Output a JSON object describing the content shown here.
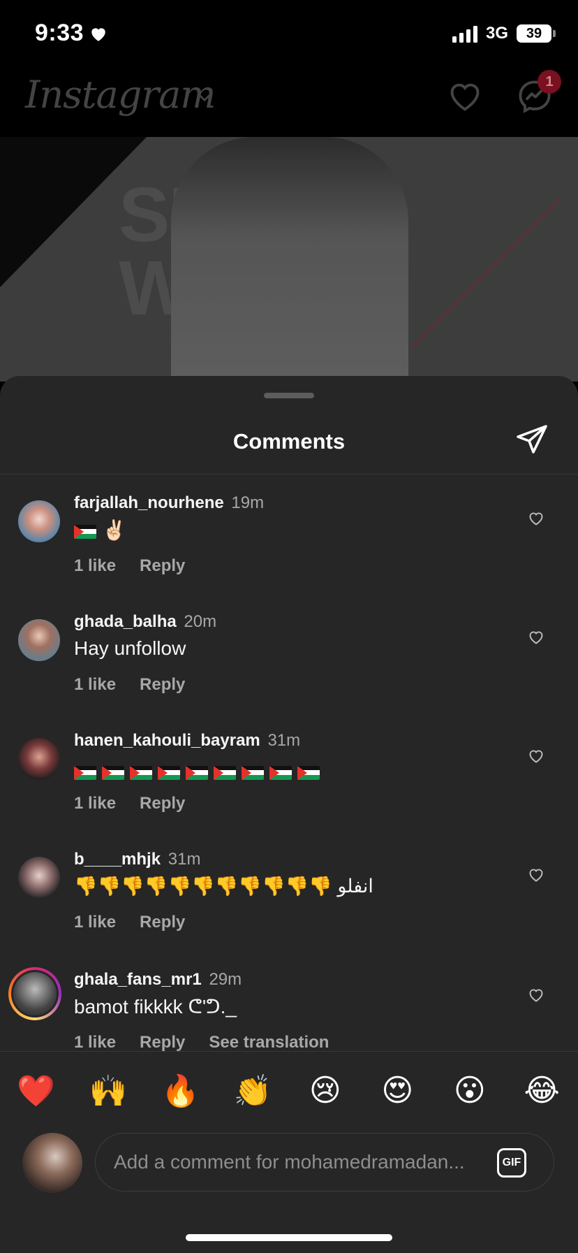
{
  "status_bar": {
    "time": "9:33",
    "network": "3G",
    "battery": "39"
  },
  "header": {
    "logo": "Instagram",
    "messages_badge": "1"
  },
  "post": {
    "bg_text_line1": "SHOW",
    "bg_text_line2": "WEEK"
  },
  "sheet": {
    "title": "Comments"
  },
  "comments": [
    {
      "user": "farjallah_nourhene",
      "time": "19m",
      "text": "✌🏻",
      "flags": 1,
      "likes": "1 like",
      "reply": "Reply"
    },
    {
      "user": "ghada_balha",
      "time": "20m",
      "text": "Hay unfollow",
      "likes": "1 like",
      "reply": "Reply"
    },
    {
      "user": "hanen_kahouli_bayram",
      "time": "31m",
      "flags": 9,
      "likes": "1 like",
      "reply": "Reply"
    },
    {
      "user": "b____mhjk",
      "time": "31m",
      "text": "👎👎👎👎👎👎👎👎👎👎👎 انفلو",
      "likes": "1 like",
      "reply": "Reply"
    },
    {
      "user": "ghala_fans_mr1",
      "time": "29m",
      "text": "bamot fikkkk ᕦ'ᕤ._",
      "likes": "1 like",
      "reply": "Reply",
      "translation": "See translation"
    }
  ],
  "reactions": [
    "❤️",
    "🙌",
    "🔥",
    "👏",
    "😢",
    "😍",
    "😮",
    "😂"
  ],
  "composer": {
    "placeholder": "Add a comment for mohamedramadan...",
    "gif_label": "GIF"
  },
  "colors": {
    "background": "#000000",
    "sheet": "#262626",
    "secondary_text": "#a8a8a8"
  }
}
